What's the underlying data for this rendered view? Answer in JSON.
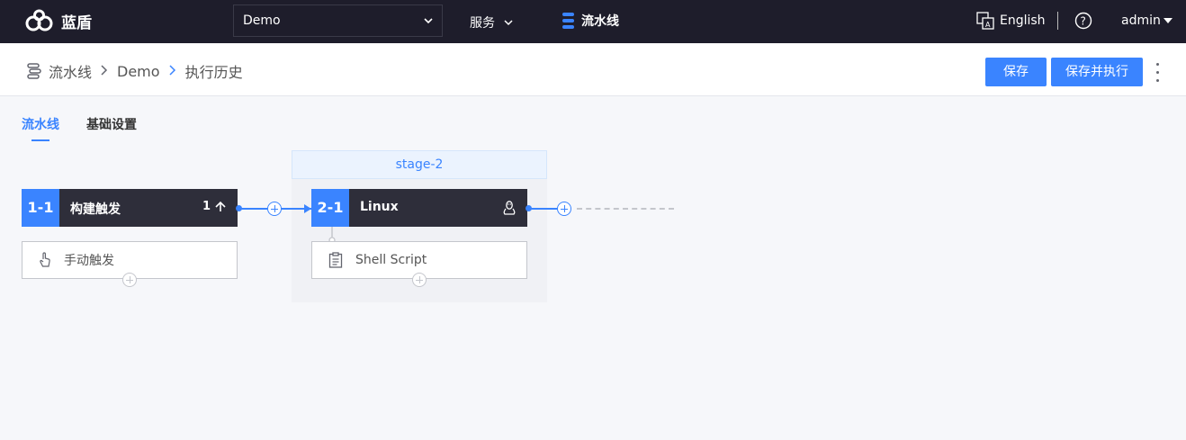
{
  "topbar": {
    "brand": "蓝盾",
    "project_value": "Demo",
    "service_label": "服务",
    "pipeline_label": "流水线",
    "language_label": "English",
    "user_label": "admin"
  },
  "breadcrumb": {
    "items": [
      "流水线",
      "Demo",
      "执行历史"
    ]
  },
  "actions": {
    "save_label": "保存",
    "save_run_label": "保存并执行"
  },
  "tabs": [
    {
      "label": "流水线",
      "active": true
    },
    {
      "label": "基础设置",
      "active": false
    }
  ],
  "pipeline": {
    "stages": [
      {
        "name": "",
        "job": {
          "index": "1-1",
          "title": "构建触发",
          "badge_count": "1"
        },
        "tasks": [
          {
            "name": "手动触发",
            "icon": "hand-pointer-icon"
          }
        ]
      },
      {
        "name": "stage-2",
        "job": {
          "index": "2-1",
          "title": "Linux",
          "os_icon": "linux-icon"
        },
        "tasks": [
          {
            "name": "Shell Script",
            "icon": "clipboard-icon"
          }
        ]
      }
    ]
  },
  "colors": {
    "topbar_bg": "#1e1d2b",
    "accent": "#3a84ff",
    "job_bg": "#2e2e3a"
  }
}
